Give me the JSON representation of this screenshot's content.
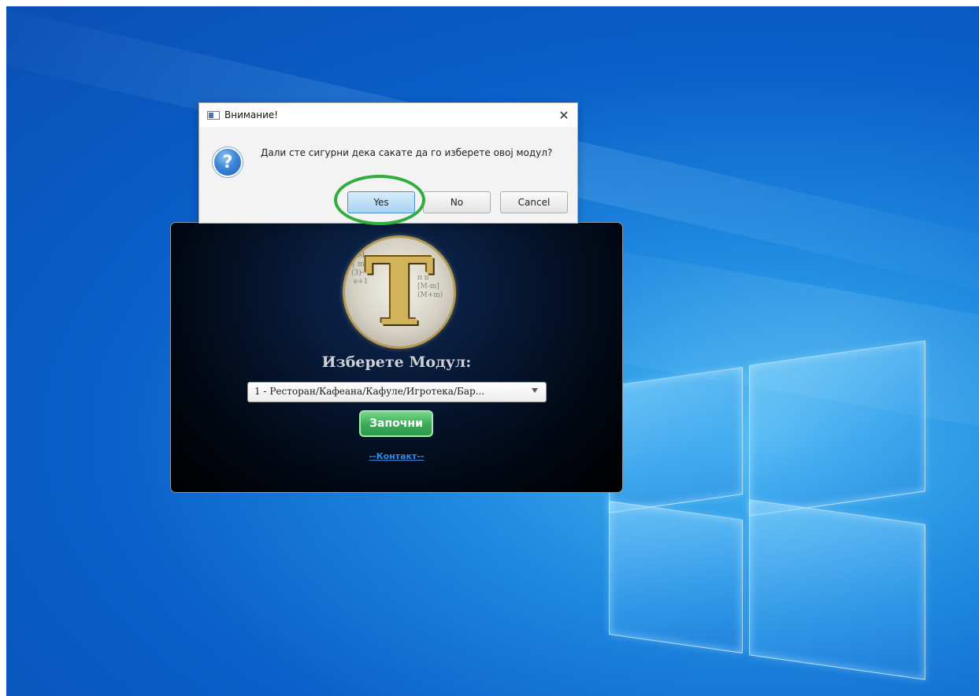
{
  "dialog": {
    "title": "Внимание!",
    "message": "Дали сте сигурни дека сакате да го изберете овој модул?",
    "close_label": "✕",
    "question_icon_glyph": "?",
    "buttons": {
      "yes": "Yes",
      "no": "No",
      "cancel": "Cancel"
    }
  },
  "app": {
    "logo_letter": "T",
    "module_label": "Изберете Модул:",
    "module_select_value": "1 - Ресторан/Кафеана/Кафуле/Игротека/Бар...",
    "start_button": "Започни",
    "contact_link": "--Контакт--"
  },
  "icons": {
    "dialog_app": "window-icon",
    "question": "question-icon",
    "close": "close-icon",
    "dropdown": "chevron-down-icon"
  },
  "colors": {
    "highlight": "#2fae3e",
    "start_button": "#3aaa58",
    "contact_link": "#2f8be0",
    "desktop_blue": "#0a5fc8"
  }
}
